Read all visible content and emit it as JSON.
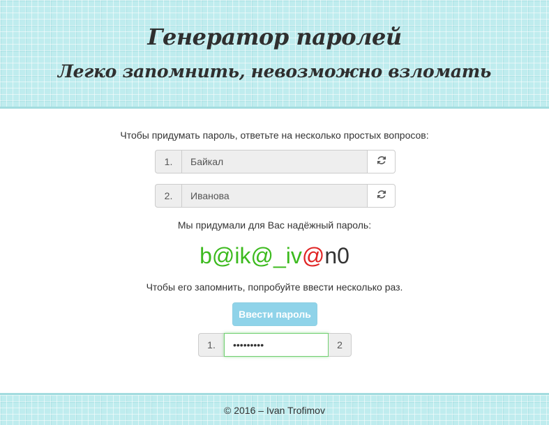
{
  "header": {
    "title": "Генератор паролей",
    "subtitle": "Легко запомнить, невозможно взломать"
  },
  "questions": {
    "prompt": "Чтобы придумать пароль, ответьте на несколько простых вопросов:",
    "items": [
      {
        "number": "1.",
        "value": "Байкал",
        "refresh_icon": "refresh-icon"
      },
      {
        "number": "2.",
        "value": "Иванова",
        "refresh_icon": "refresh-icon"
      }
    ]
  },
  "result": {
    "label": "Мы придумали для Вас надёжный пароль:",
    "password_parts": [
      {
        "text": "b@ik@_iv",
        "color": "#3cba1e"
      },
      {
        "text": "@",
        "color": "#e02424"
      },
      {
        "text": "n0",
        "color": "#333333"
      }
    ]
  },
  "practice": {
    "hint": "Чтобы его запомнить, попробуйте ввести несколько раз.",
    "enter_button": "Ввести пароль",
    "attempt_number": "1.",
    "attempt_value": "•••••••••",
    "attempt_count": "2"
  },
  "footer": {
    "text": "© 2016 – Ivan Trofimov"
  }
}
